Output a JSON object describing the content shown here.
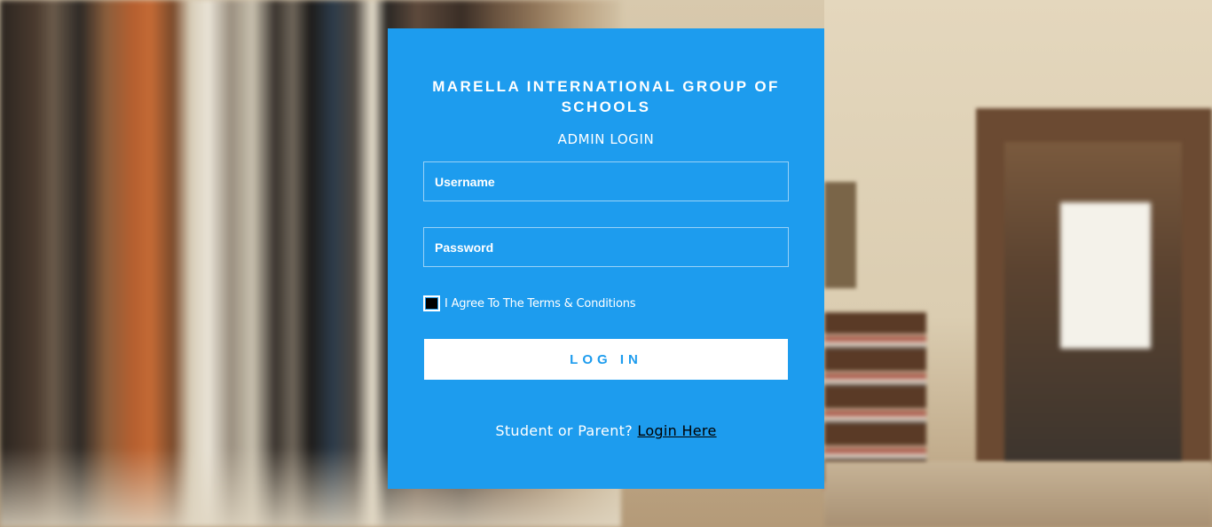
{
  "colors": {
    "card_background": "#1d9cee",
    "card_text": "#ffffff",
    "button_background": "#ffffff",
    "button_text": "#1d9cee",
    "link_text": "#000000"
  },
  "login_card": {
    "org_title": "MARELLA INTERNATIONAL GROUP OF SCHOOLS",
    "subtitle": "ADMIN LOGIN",
    "username": {
      "placeholder": "Username",
      "value": ""
    },
    "password": {
      "placeholder": "Password",
      "value": ""
    },
    "terms": {
      "label": "I Agree To The Terms & Conditions",
      "checked": false
    },
    "login_button_label": "LOG IN",
    "alt_prompt": "Student or Parent?",
    "alt_link_label": "Login Here"
  }
}
